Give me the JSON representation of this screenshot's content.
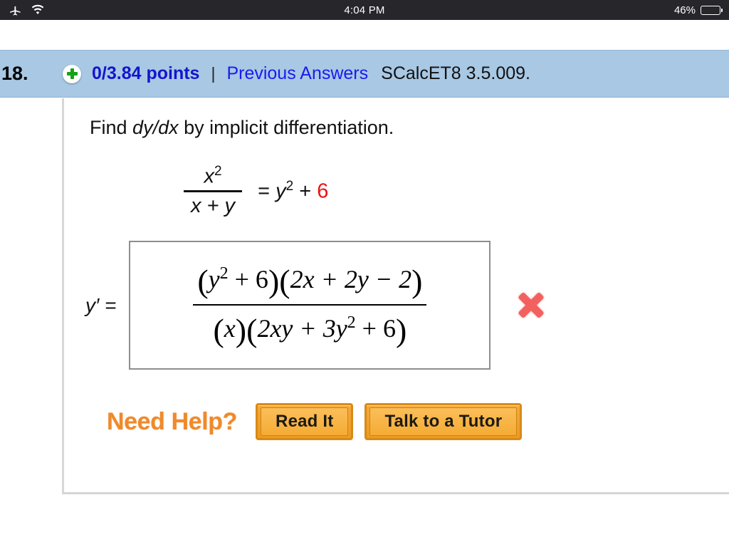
{
  "statusbar": {
    "time": "4:04 PM",
    "battery_percent": "46%",
    "battery_level": 46,
    "icons": [
      "airplane-mode-icon",
      "wifi-icon",
      "battery-icon"
    ]
  },
  "question_header": {
    "number": "18.",
    "add_icon": "green-plus-icon",
    "points": "0/3.84 points",
    "separator": "|",
    "previous_answers": "Previous Answers",
    "exercise_code": "SCalcET8 3.5.009.",
    "background_color": "#a8c8e4",
    "points_color": "#1414cf",
    "link_color": "#1a1af0"
  },
  "problem": {
    "prompt_before": "Find",
    "prompt_italic": "dy/dx",
    "prompt_after": "by implicit differentiation.",
    "equation": {
      "numerator_base": "x",
      "numerator_exponent": "2",
      "denominator": "x + y",
      "equals": "=",
      "rhs_base": "y",
      "rhs_exponent": "2",
      "rhs_plus": "+",
      "rhs_constant": "6",
      "rhs_constant_color": "#ee1111"
    }
  },
  "answer": {
    "label": "y′ =",
    "numerator": {
      "open1": "(",
      "var1": "y",
      "exp1": "2",
      "plus1": "+ 6",
      "close1": ")",
      "open2": "(",
      "body2": "2x + 2y − 2",
      "close2": ")"
    },
    "denominator": {
      "open1": "(",
      "var1": "x",
      "close1": ")",
      "open2": "(",
      "body2": "2xy + 3y",
      "exp2": "2",
      "tail2": "+ 6",
      "close2": ")"
    },
    "status_icon": "red-x-incorrect-icon",
    "status_color": "#f2615f",
    "box_border_color": "#8e8e8e"
  },
  "help": {
    "title": "Need Help?",
    "title_color": "#ef8a2b",
    "buttons": [
      {
        "label": "Read It"
      },
      {
        "label": "Talk to a Tutor"
      }
    ]
  }
}
